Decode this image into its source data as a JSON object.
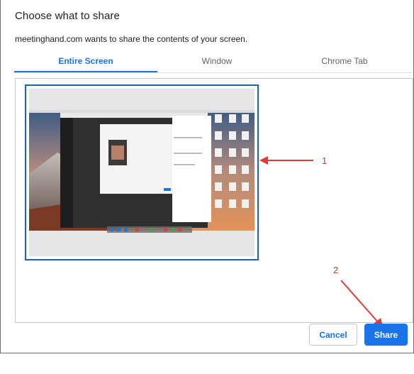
{
  "dialog": {
    "title": "Choose what to share",
    "subtitle": "meetinghand.com wants to share the contents of your screen."
  },
  "tabs": [
    {
      "label": "Entire Screen",
      "active": true
    },
    {
      "label": "Window",
      "active": false
    },
    {
      "label": "Chrome Tab",
      "active": false
    }
  ],
  "annotations": {
    "marker_1": "1",
    "marker_2": "2"
  },
  "buttons": {
    "cancel": "Cancel",
    "share": "Share"
  },
  "colors": {
    "accent": "#1a73e8",
    "selection_border": "#1565c0",
    "annotation_red": "#e53935"
  }
}
